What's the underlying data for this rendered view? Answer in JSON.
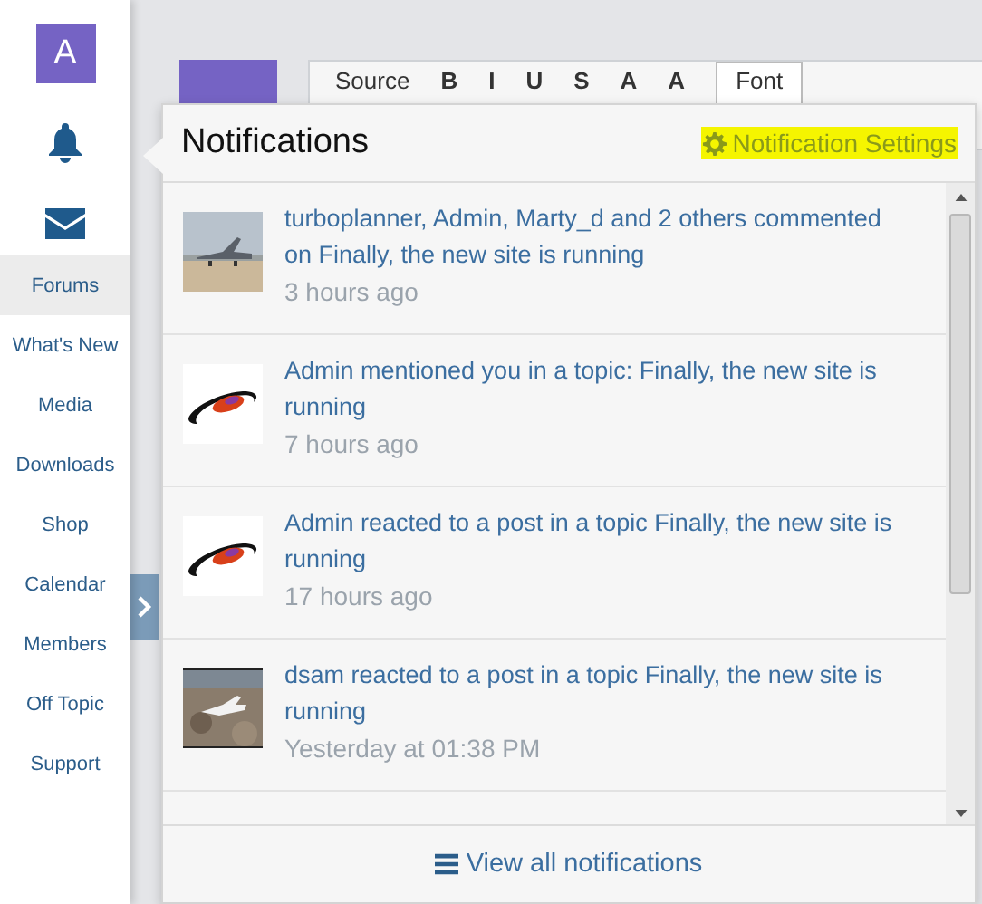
{
  "sidebar": {
    "avatar": "A",
    "nav": [
      {
        "label": "Forums",
        "selected": true
      },
      {
        "label": "What's New",
        "selected": false
      },
      {
        "label": "Media",
        "selected": false
      },
      {
        "label": "Downloads",
        "selected": false
      },
      {
        "label": "Shop",
        "selected": false
      },
      {
        "label": "Calendar",
        "selected": false
      },
      {
        "label": "Members",
        "selected": false
      },
      {
        "label": "Off Topic",
        "selected": false
      },
      {
        "label": "Support",
        "selected": false
      }
    ]
  },
  "editor": {
    "toolbar": [
      "Source",
      "B",
      "I",
      "U",
      "S",
      "A",
      "A",
      "Font"
    ]
  },
  "popup": {
    "title": "Notifications",
    "settings_link": "Notification Settings",
    "notifications": [
      {
        "kind": "jet",
        "text": "turboplanner, Admin, Marty_d and 2 others commented on Finally, the new site is running",
        "time": "3 hours ago"
      },
      {
        "kind": "logo",
        "text": "Admin mentioned you in a topic: Finally, the new site is running",
        "time": "7 hours ago"
      },
      {
        "kind": "logo",
        "text": "Admin reacted to a post in a topic Finally, the new site is running",
        "time": "17 hours ago"
      },
      {
        "kind": "plane",
        "text": "dsam reacted to a post in a topic Finally, the new site is running",
        "time": "Yesterday at 01:38 PM"
      }
    ],
    "footer_link": "View all notifications"
  }
}
